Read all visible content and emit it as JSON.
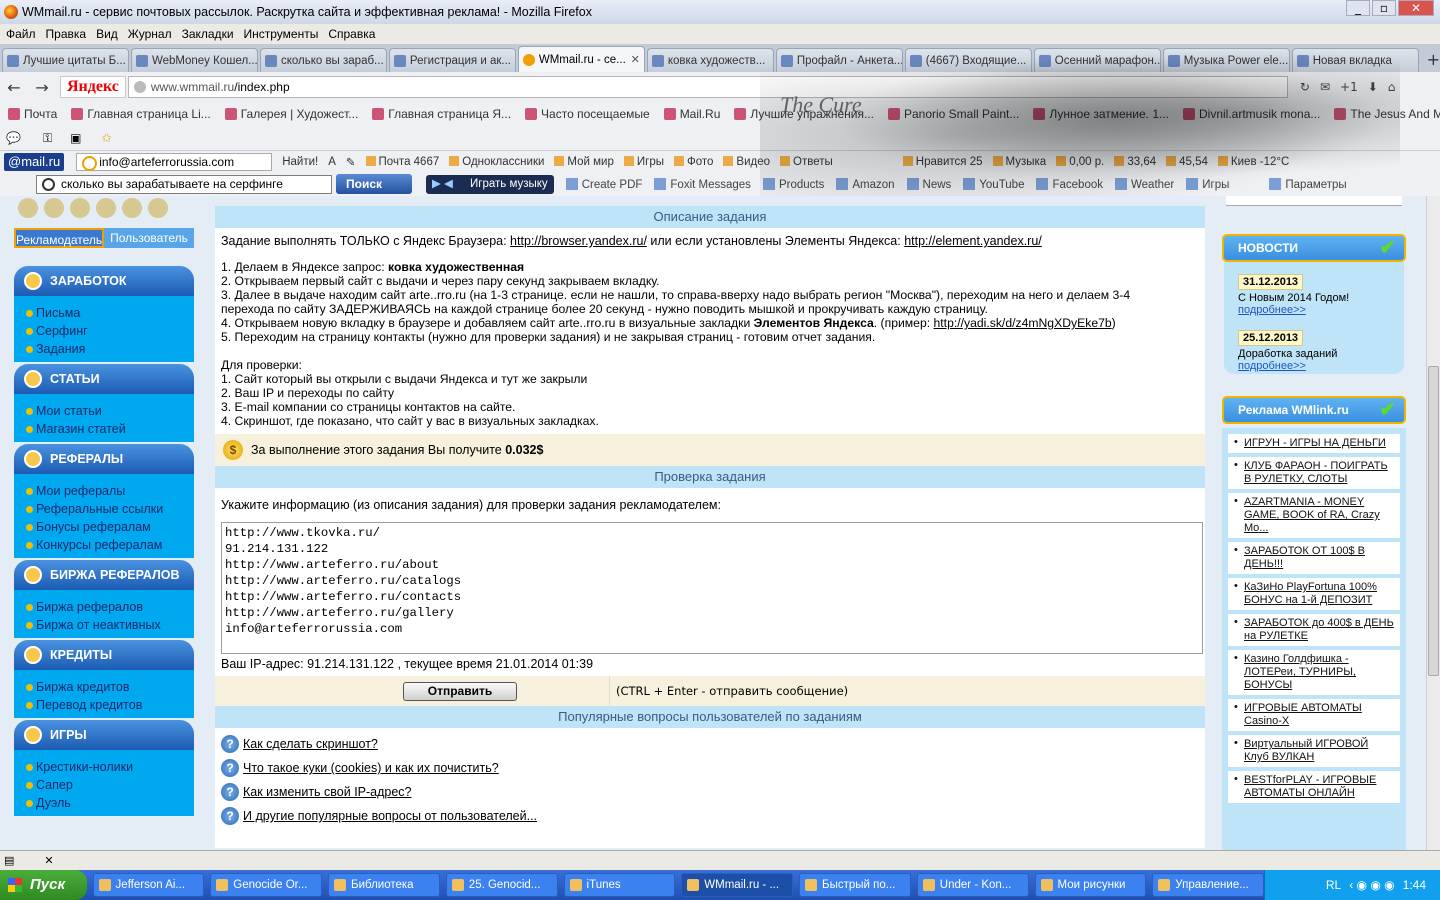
{
  "window": {
    "title": "WMmail.ru - сервис почтовых рассылок. Раскрутка сайта и эффективная реклама! - Mozilla Firefox"
  },
  "menu": [
    "Файл",
    "Правка",
    "Вид",
    "Журнал",
    "Закладки",
    "Инструменты",
    "Справка"
  ],
  "tabs": [
    {
      "label": "Лучшие цитаты Б..."
    },
    {
      "label": "WebMoney Кошел..."
    },
    {
      "label": "сколько вы зараб..."
    },
    {
      "label": "Регистрация и ак..."
    },
    {
      "label": "WMmail.ru - се...",
      "active": true
    },
    {
      "label": "ковка художеств..."
    },
    {
      "label": "Профайл - Анкета..."
    },
    {
      "label": "(4667) Входящие..."
    },
    {
      "label": "Осенний марафон..."
    },
    {
      "label": "Музыка Power ele..."
    },
    {
      "label": "Новая вкладка"
    }
  ],
  "nav": {
    "yandex_logo": "Яндекс",
    "url_host": "www.wmmail.ru",
    "url_path": "/index.php",
    "plus_one": "+1"
  },
  "bookmarks": [
    "Почта",
    "Главная страница Li...",
    "Галерея | Художест...",
    "Главная страница Я...",
    "Часто посещаемые",
    "Mail.Ru",
    "Лучшие упражнения...",
    "Panorio Small Paint...",
    "Лунное затмение. 1...",
    "Divnil.artmusik mona...",
    "The Jesus And Mary ..."
  ],
  "mailbar": {
    "logo": "@mail.ru",
    "email": "info@arteferrorussia.com",
    "find": "Найти!",
    "items": [
      "Почта 4667",
      "Одноклассники",
      "Мой мир",
      "Игры",
      "Фото",
      "Видео",
      "Ответы",
      "Нравится 25",
      "Музыка",
      "0,00 р.",
      "33,64",
      "45,54",
      "Киев -12°C"
    ]
  },
  "askbar": {
    "search_value": "сколько вы зарабатываете на серфинге",
    "search_button": "Поиск",
    "play": "Играть музыку",
    "items": [
      "Create PDF",
      "Foxit Messages",
      "Products",
      "Amazon",
      "News",
      "YouTube",
      "Facebook",
      "Weather",
      "Игры",
      "Параметры"
    ]
  },
  "banner": {
    "text": "The Cure"
  },
  "sidebar": {
    "login_advertiser": "Рекламодатель",
    "login_user": "Пользователь",
    "sections": [
      {
        "title": "ЗАРАБОТОК",
        "items": [
          "Письма",
          "Серфинг",
          "Задания"
        ]
      },
      {
        "title": "СТАТЬИ",
        "items": [
          "Мои статьи",
          "Магазин статей"
        ]
      },
      {
        "title": "РЕФЕРАЛЫ",
        "items": [
          "Мои рефералы",
          "Реферальные ссылки",
          "Бонусы рефералам",
          "Конкурсы рефералам"
        ]
      },
      {
        "title": "БИРЖА РЕФЕРАЛОВ",
        "items": [
          "Биржа рефералов",
          "Биржа от неактивных"
        ]
      },
      {
        "title": "КРЕДИТЫ",
        "items": [
          "Биржа кредитов",
          "Перевод кредитов"
        ]
      },
      {
        "title": "ИГРЫ",
        "items": [
          "Крестики-нолики",
          "Сапер",
          "Дуэль"
        ]
      }
    ]
  },
  "main": {
    "desc_title": "Описание задания",
    "intro_pre": "Задание выполнять ТОЛЬКО с Яндекс Браузера: ",
    "intro_link1": "http://browser.yandex.ru/",
    "intro_mid": " или если установлены Элементы Яндекса: ",
    "intro_link2": "http://element.yandex.ru/",
    "step1_pre": "1. Делаем в Яндексе запрос: ",
    "step1_bold": "ковка художественная",
    "step2": "2. Открываем первый сайт с выдачи и через пару секунд закрываем вкладку.",
    "step3a": "3. Далее в выдаче находим сайт arte..rro.ru (на 1-3 странице. если не нашли, то справа-вверху надо выбрать регион \"Москва\"), переходим на него и делаем 3-4",
    "step3b": "перехода по сайту ЗАДЕРЖИВАЯСЬ на каждой странице более 20 секунд - нужно поводить мышкой и прокручивать каждую страницу.",
    "step4_pre": "4. Открываем новую вкладку в браузере и добавляем сайт arte..rro.ru в визуальные закладки ",
    "step4_bold": "Элементов Яндекса",
    "step4_mid": ". (пример: ",
    "step4_link": "http://yadi.sk/d/z4mNgXDyEke7b",
    "step4_end": ")",
    "step5": "5. Переходим на страницу контакты (нужно для проверки задания) и не закрывая страниц - готовим отчет задания.",
    "check_title": "Для проверки:",
    "check1": "1. Сайт который вы открыли с выдачи Яндекса и тут же закрыли",
    "check2": "2. Ваш IP и переходы по сайту",
    "check3": "3. E-mail компании со страницы контактов на сайте.",
    "check4": "4. Скриншот, где показано, что сайт у вас в визуальных закладках.",
    "reward_text": "За выполнение этого задания Вы получите ",
    "reward_value": "0.032$",
    "verify_title": "Проверка задания",
    "verify_prompt": "Укажите информацию (из описания задания) для проверки задания рекламодателем:",
    "textarea_value": "http://www.tkovka.ru/\n91.214.131.122\nhttp://www.arteferro.ru/about\nhttp://www.arteferro.ru/catalogs\nhttp://www.arteferro.ru/contacts\nhttp://www.arteferro.ru/gallery\ninfo@arteferrorussia.com\n",
    "ip_line": "Ваш IP-адрес: 91.214.131.122 , текущее время 21.01.2014 01:39",
    "send_button": "Отправить",
    "send_hint": "(CTRL + Enter - отправить сообщение)",
    "faq_title": "Популярные вопросы пользователей по заданиям",
    "faq": [
      "Как сделать скриншот?",
      "Что такое куки (cookies) и как их почистить?",
      "Как изменить свой IP-адрес?",
      "И другие популярные вопросы от пользователей..."
    ]
  },
  "right": {
    "news_title": "НОВОСТИ",
    "news": [
      {
        "date": "31.12.2013",
        "text": "С Новым 2014 Годом!",
        "more": "подробнее>>"
      },
      {
        "date": "25.12.2013",
        "text": "Доработка заданий",
        "more": "подробнее>>"
      }
    ],
    "ads_title": "Реклама WMlink.ru",
    "ads": [
      "ИГРУН - ИГРЫ НА ДЕНЬГИ",
      "КЛУБ ФАРАОН - ПОИГРАТЬ В РУЛЕТКУ, СЛОТЫ",
      "AZARTMANIA - MONEY GAME, BOOK of RA, Crazy Mo...",
      "ЗАРАБОТОК ОТ 100$ В ДЕНЬ!!!",
      "КаЗиНо PlayFortuna 100% БОНУС на 1-й ДЕПОЗИТ",
      "ЗАРАБОТОК до 400$ в ДЕНЬ на РУЛЕТКЕ",
      "Казино Голдфишка - ЛОТЕРеи, ТУРНИРЫ, БОНУСЫ",
      "ИГРОВЫЕ АВТОМАТЫ Casino-X",
      "Виртуальный ИГРОВОЙ Клуб ВУЛКАН",
      "BESTforPLAY - ИГРОВЫЕ АВТОМАТЫ ОНЛАЙН"
    ]
  },
  "taskbar": {
    "start": "Пуск",
    "items": [
      "Jefferson Ai...",
      "Genocide Or...",
      "Библиотека",
      "25. Genocid...",
      "iTunes",
      "WMmail.ru - ...",
      "Быстрый по...",
      "Under - Kon...",
      "Мои рисунки",
      "Управление..."
    ],
    "lang": "RL",
    "clock": "1:44"
  }
}
